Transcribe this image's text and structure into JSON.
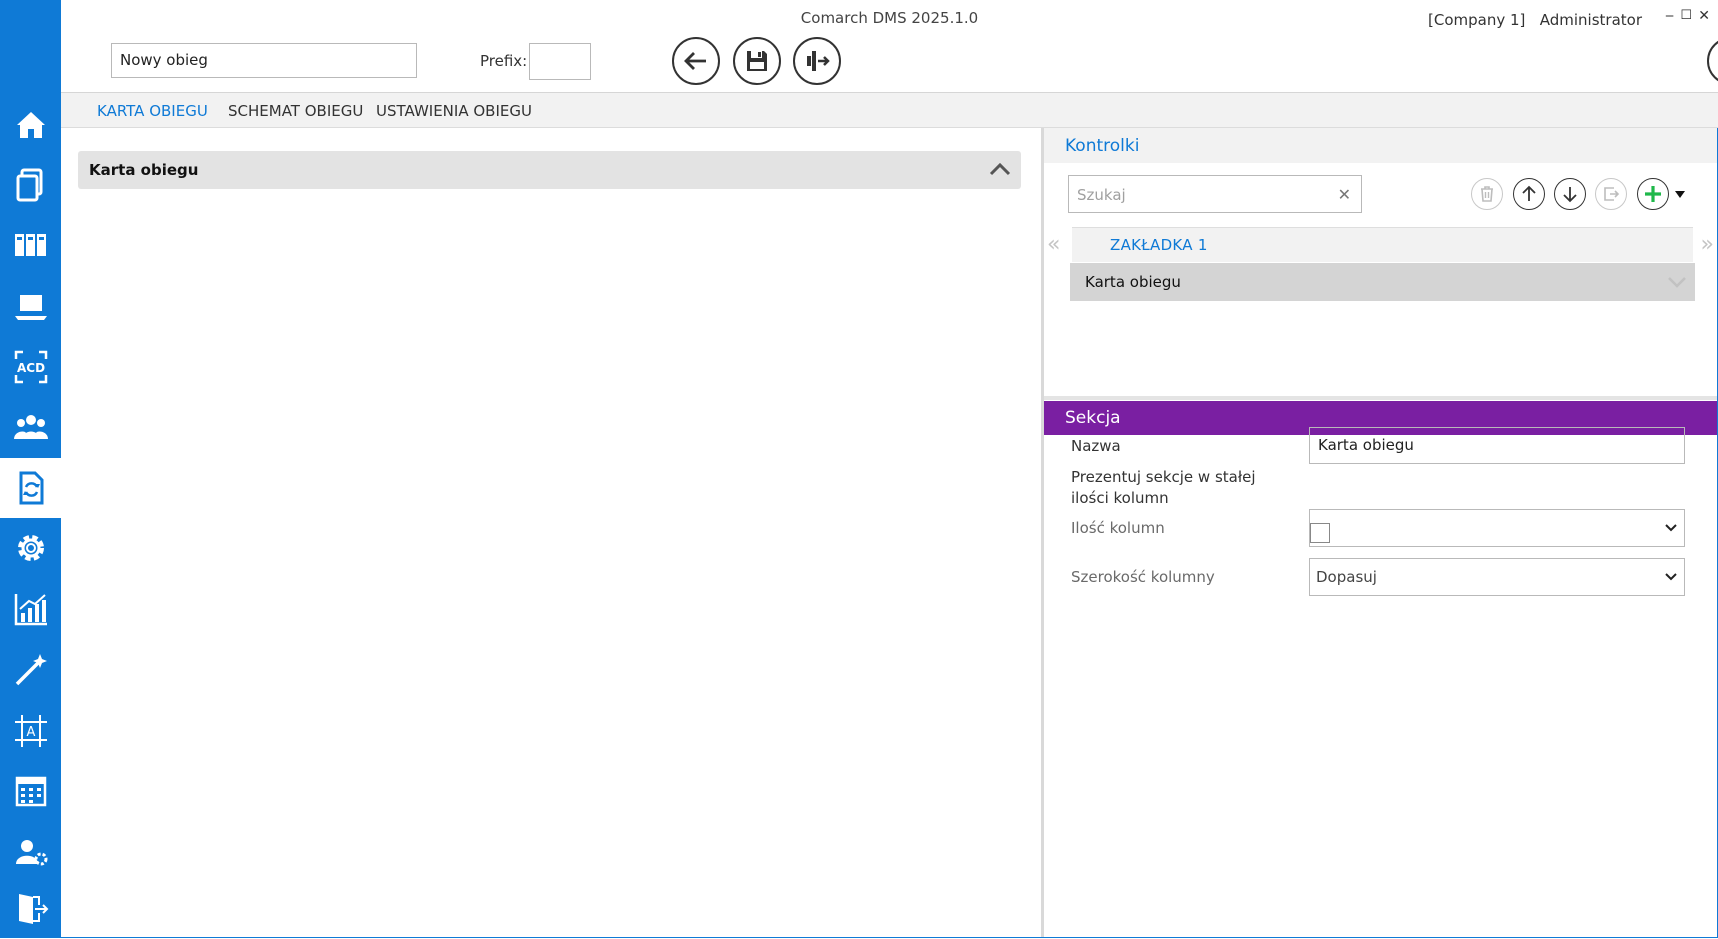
{
  "window": {
    "title": "Comarch DMS 2025.1.0",
    "company": "[Company 1]",
    "user": "Administrator",
    "minimize": "‒",
    "maximize": "☐",
    "close": "✕"
  },
  "toolbar": {
    "name_value": "Nowy obieg",
    "prefix_label": "Prefix:",
    "prefix_value": ""
  },
  "tabs": [
    {
      "label": "KARTA OBIEGU",
      "active": true
    },
    {
      "label": "SCHEMAT OBIEGU",
      "active": false
    },
    {
      "label": "USTAWIENIA OBIEGU",
      "active": false
    }
  ],
  "left": {
    "section_label": "Karta obiegu"
  },
  "kontrolki": {
    "title": "Kontrolki",
    "search_placeholder": "Szukaj",
    "clear": "✕",
    "tab_label": "ZAKŁADKA 1",
    "prev": "«",
    "next": "»",
    "item_label": "Karta obiegu"
  },
  "sekcja": {
    "title": "Sekcja",
    "nazwa_label": "Nazwa",
    "nazwa_value": "Karta obiegu",
    "prezentuj_label": "Prezentuj sekcje w stałej ilości kolumn",
    "prezentuj_checked": false,
    "ilosc_label": "Ilość kolumn",
    "ilosc_value": "",
    "szerokosc_label": "Szerokość kolumny",
    "szerokosc_value": "Dopasuj"
  },
  "colors": {
    "accent": "#0f7ad6",
    "section": "#7a1fa2",
    "add": "#1fb84a"
  },
  "sidebar_icons": [
    "home-icon",
    "documents-icon",
    "binders-icon",
    "laptop-icon",
    "acd-icon",
    "users-icon",
    "workflow-icon",
    "gear-icon",
    "reports-icon",
    "magic-wand-icon",
    "designer-icon",
    "calendar-icon",
    "user-settings-icon",
    "logout-icon"
  ]
}
